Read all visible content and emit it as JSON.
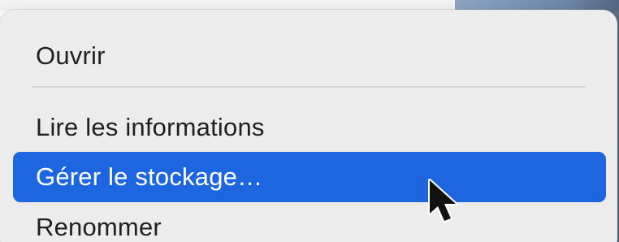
{
  "menu": {
    "items": [
      {
        "label": "Ouvrir"
      },
      {
        "label": "Lire les informations"
      },
      {
        "label": "Gérer le stockage…"
      },
      {
        "label": "Renommer"
      }
    ],
    "highlight_color": "#1d66df"
  },
  "icons": {
    "cursor": "mouse-pointer-icon"
  }
}
